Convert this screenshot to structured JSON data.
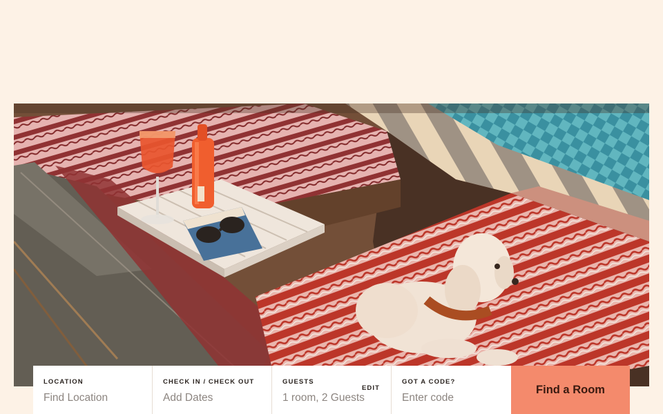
{
  "hero": {
    "image": "poolside-lounger-dog-photo"
  },
  "booking": {
    "location": {
      "label": "LOCATION",
      "placeholder": "Find Location"
    },
    "dates": {
      "label": "CHECK IN / CHECK OUT",
      "value": "Add Dates"
    },
    "guests": {
      "label": "GUESTS",
      "value": "1 room, 2 Guests",
      "edit_label": "EDIT"
    },
    "code": {
      "label": "GOT A CODE?",
      "placeholder": "Enter code"
    },
    "submit_label": "Find a Room"
  },
  "colors": {
    "page_bg": "#fdf2e6",
    "button_bg": "#f48a6c",
    "button_text": "#3a1a10"
  }
}
